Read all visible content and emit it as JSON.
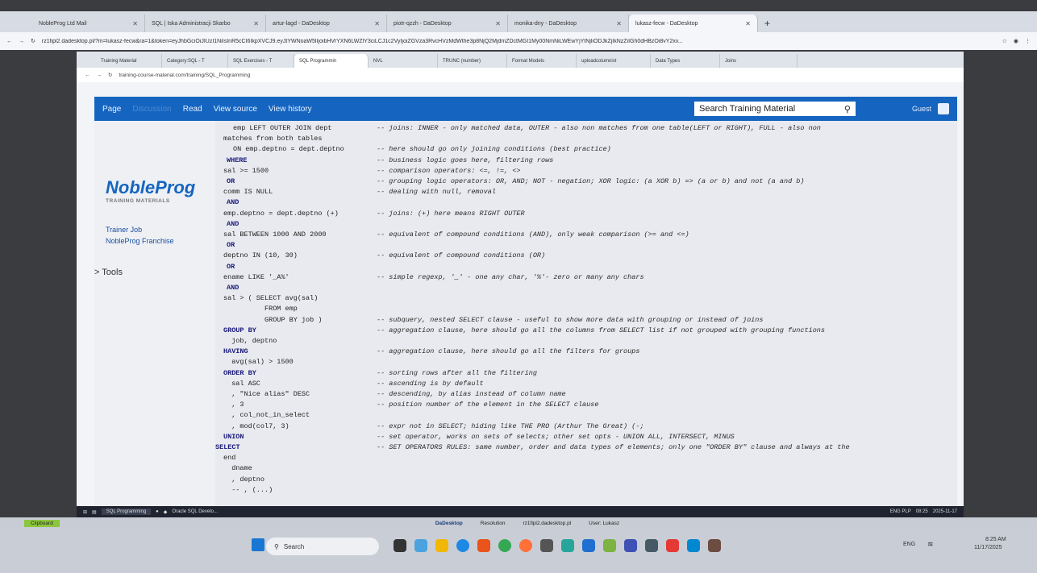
{
  "outer_tabs": [
    "NobleProg Ltd Mail",
    "SQL | Iska Administracji Skarbo",
    "artur-lagd - DaDesktop",
    "piotr-qzzh - DaDesktop",
    "monika-dny - DaDesktop",
    "lukasz-fecw - DaDesktop"
  ],
  "outer_url": "rz1fipl2.dadesktop.pl/?m=lukasz-fecw&ra=1&token=eyJhbGciOiJIUzI1NiIsInR5cCI6IkpXVCJ9.eyJtYWNoaW5lIjoibHVrYXN6LWZlY3ciLCJ1c2VyIjoiZGVza3RvcHVzMdWthe3p8NjQ2MjdmZDctMGI1My00NmNiLWEwYjYtNjliODJkZjIkNzZiIGh0dHBzOi8vY2xv...",
  "inner_tabs": [
    "Training Material",
    "Category:SQL - T",
    "SQL Exercises - T",
    "SQL Programmin",
    "NVL",
    "TRUNC (number)",
    "Format Models",
    "uploadcolumnist",
    "Data Types",
    "Joins"
  ],
  "inner_url": "training-course-material.com/training/SQL_Programming",
  "wiki_tabs": [
    "Page",
    "Discussion",
    "Read",
    "View source",
    "View history"
  ],
  "search_placeholder": "Search Training Material",
  "guest_label": "Guest",
  "logo_title": "NobleProg",
  "logo_subtitle": "TRAINING MATERIALS",
  "sidebar_links": [
    "Trainer Job",
    "NobleProg Franchise"
  ],
  "tools_label": "> Tools",
  "code_lines": [
    {
      "code": "emp LEFT OUTER JOIN dept",
      "comment": "-- joins: INNER - only matched data, OUTER - also non matches from one table(LEFT or RIGHT), FULL - also non"
    },
    {
      "code": "matches from both tables",
      "comment": ""
    },
    {
      "code": "ON emp.deptno = dept.deptno",
      "comment": "-- here should go only joining conditions (best practice)"
    },
    {
      "code": "WHERE",
      "comment": "-- business logic goes here, filtering rows"
    },
    {
      "code": "sal >= 1500",
      "comment": "-- comparison operators: <=, !=, <>"
    },
    {
      "code": "OR",
      "comment": "-- grouping logic operators: OR, AND; NOT - negation; XOR logic: (a XOR b) => (a or b) and not (a and b)"
    },
    {
      "code": "comm IS NULL",
      "comment": "-- dealing with null, removal"
    },
    {
      "code": "AND",
      "comment": ""
    },
    {
      "code": "emp.deptno = dept.deptno (+)",
      "comment": "-- joins: (+) here means RIGHT OUTER"
    },
    {
      "code": "AND",
      "comment": ""
    },
    {
      "code": "sal BETWEEN 1000 AND 2000",
      "comment": "-- equivalent of compound conditions (AND), only weak comparison (>= and <=)"
    },
    {
      "code": "OR",
      "comment": ""
    },
    {
      "code": "deptno IN (10, 30)",
      "comment": "-- equivalent of compound conditions (OR)"
    },
    {
      "code": "OR",
      "comment": ""
    },
    {
      "code": "ename LIKE '_A%'",
      "comment": "-- simple regexp, '_' - one any char, '%'- zero or many any chars"
    },
    {
      "code": "AND",
      "comment": ""
    },
    {
      "code": "sal > ( SELECT avg(sal)",
      "comment": ""
    },
    {
      "code": "          FROM emp",
      "comment": ""
    },
    {
      "code": "          GROUP BY job )",
      "comment": "-- subquery, nested SELECT clause - useful to show more data with grouping or instead of joins"
    },
    {
      "code": "GROUP BY",
      "comment": "-- aggregation clause, here should go all the columns from SELECT list if not grouped with grouping functions"
    },
    {
      "code": "  job, deptno",
      "comment": ""
    },
    {
      "code": "HAVING",
      "comment": "-- aggregation clause, here should go all the filters for groups"
    },
    {
      "code": "  avg(sal) > 1500",
      "comment": ""
    },
    {
      "code": "ORDER BY",
      "comment": "-- sorting rows after all the filtering"
    },
    {
      "code": "  sal ASC",
      "comment": "-- ascending is by default"
    },
    {
      "code": "  , \"Nice alias\" DESC",
      "comment": "-- descending, by alias instead of column name"
    },
    {
      "code": "  , 3",
      "comment": "-- position number of the element in the SELECT clause"
    },
    {
      "code": "  , col_not_in_select",
      "comment": ""
    },
    {
      "code": "  , mod(col7, 3)",
      "comment": "-- expr not in SELECT; hiding like THE PRO (Arthur The Great) (-;"
    },
    {
      "code": "UNION",
      "comment": "-- set operator, works on sets of selects; other set opts - UNION ALL, INTERSECT, MINUS"
    },
    {
      "code": "SELECT",
      "comment": "-- SET OPERATORS RULES: same number, order and data types of elements; only one \"ORDER BY\" clause and always at the"
    },
    {
      "code": "end",
      "comment": ""
    },
    {
      "code": "  dname",
      "comment": ""
    },
    {
      "code": "  , deptno",
      "comment": ""
    },
    {
      "code": "  -- , (...)",
      "comment": ""
    }
  ],
  "remote_taskbar_items": [
    "SQL Programming",
    "Oracle SQL Develo..."
  ],
  "rdp_bar": {
    "clipboard": "Clipboard",
    "center": "DaDesktop",
    "resolution": "Resolution",
    "host": "rz1fipl2.dadesktop.pl",
    "user": "User: Lukasz"
  },
  "remote_tray": {
    "lang": "ENG PLP",
    "time": "08:25",
    "date": "2025-11-17"
  },
  "host_search": "Search",
  "host_tray": {
    "lang": "ENG",
    "time": "8:25 AM",
    "date": "11/17/2025"
  },
  "colors": {
    "accent": "#1565c0",
    "taskbar": "#c9cdd6"
  }
}
